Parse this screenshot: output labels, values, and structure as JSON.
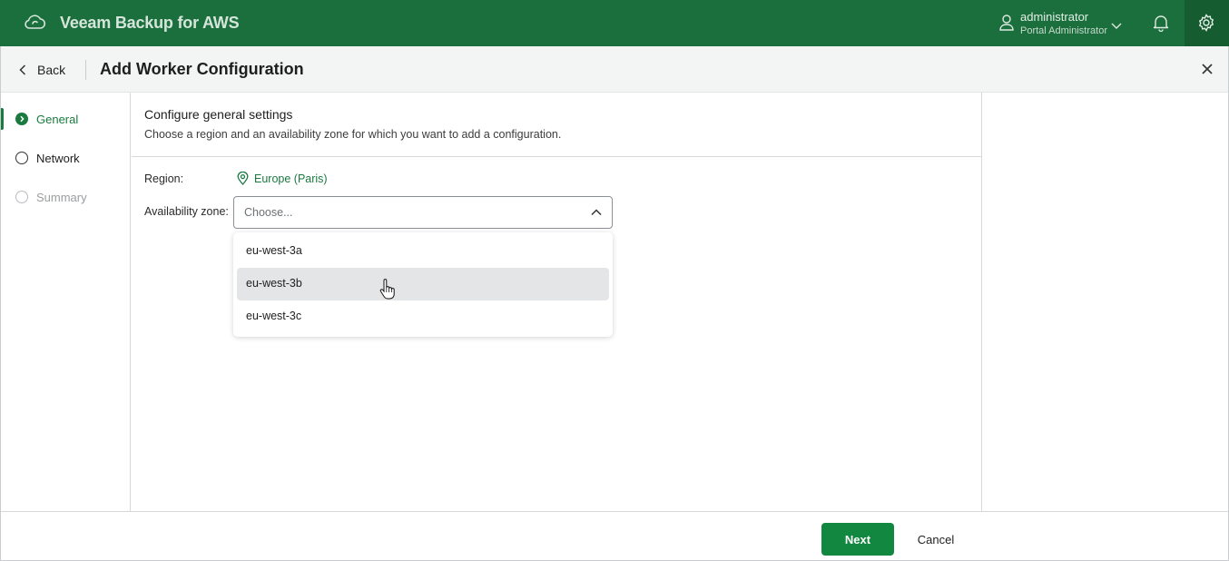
{
  "header": {
    "app_title": "Veeam Backup for AWS",
    "user_name": "administrator",
    "user_role": "Portal Administrator",
    "brand_color": "#1a6f3c",
    "icons": [
      "cloud-icon",
      "user-icon",
      "chevron-down-icon",
      "bell-icon",
      "gear-icon"
    ]
  },
  "titlebar": {
    "back_label": "Back",
    "title": "Add Worker Configuration"
  },
  "steps": [
    {
      "label": "General",
      "state": "active"
    },
    {
      "label": "Network",
      "state": "upcoming"
    },
    {
      "label": "Summary",
      "state": "disabled"
    }
  ],
  "main": {
    "section_title": "Configure general settings",
    "section_desc": "Choose a region and an availability zone for which you want to add a configuration.",
    "region_label": "Region:",
    "region_value": "Europe (Paris)",
    "az_label": "Availability zone:",
    "az_placeholder": "Choose...",
    "az_options": [
      "eu-west-3a",
      "eu-west-3b",
      "eu-west-3c"
    ],
    "az_hovered_option": "eu-west-3b"
  },
  "footer": {
    "next_label": "Next",
    "cancel_label": "Cancel"
  }
}
